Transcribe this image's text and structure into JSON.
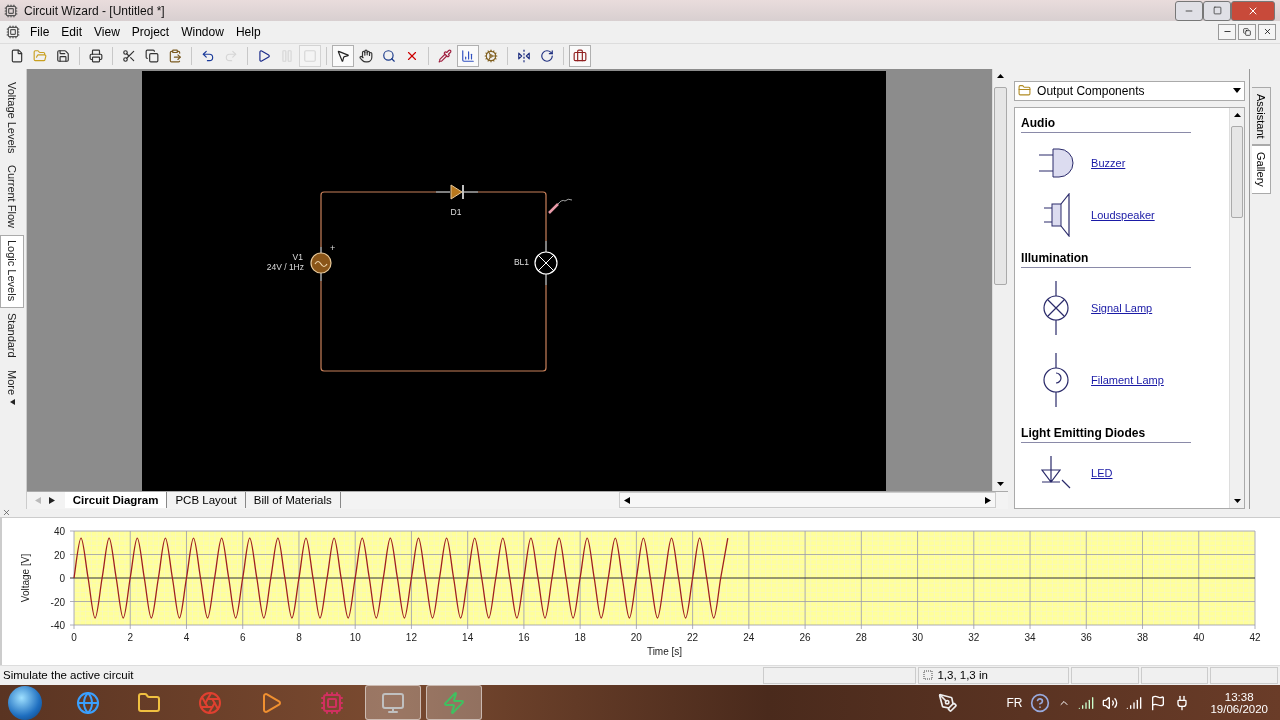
{
  "window": {
    "title": "Circuit Wizard - [Untitled *]"
  },
  "menu": [
    "File",
    "Edit",
    "View",
    "Project",
    "Window",
    "Help"
  ],
  "toolbar": [
    {
      "disabled": false,
      "pressed": false
    },
    {
      "disabled": false,
      "pressed": false
    },
    {
      "disabled": false,
      "pressed": false
    },
    {
      "disabled": false,
      "pressed": false
    },
    {
      "disabled": false,
      "pressed": false
    },
    {
      "disabled": false,
      "pressed": false
    },
    {
      "disabled": false,
      "pressed": false
    },
    {
      "disabled": false,
      "pressed": false
    },
    {
      "disabled": true,
      "pressed": false
    },
    {
      "disabled": false,
      "pressed": false
    },
    {
      "disabled": true,
      "pressed": false
    },
    {
      "disabled": true,
      "pressed": true
    },
    {
      "disabled": false,
      "pressed": true
    },
    {
      "disabled": false,
      "pressed": false
    },
    {
      "disabled": false,
      "pressed": false
    },
    {
      "disabled": false,
      "pressed": false
    },
    {
      "disabled": false,
      "pressed": false
    },
    {
      "disabled": false,
      "pressed": true
    },
    {
      "disabled": false,
      "pressed": false
    },
    {
      "disabled": false,
      "pressed": false
    },
    {
      "disabled": false,
      "pressed": false
    },
    {
      "disabled": false,
      "pressed": true
    }
  ],
  "view_tabs": [
    {
      "label": "Voltage Levels",
      "selected": false,
      "dropdown": false
    },
    {
      "label": "Current Flow",
      "selected": false,
      "dropdown": false
    },
    {
      "label": "Logic Levels",
      "selected": true,
      "dropdown": false
    },
    {
      "label": "Standard",
      "selected": false,
      "dropdown": false
    },
    {
      "label": "More",
      "selected": false,
      "dropdown": true
    }
  ],
  "diagram": {
    "components": [
      {
        "kind": "source",
        "name": "V1",
        "value": "24V / 1Hz",
        "polarity": "+"
      },
      {
        "kind": "diode",
        "name": "D1"
      },
      {
        "kind": "lamp",
        "name": "BL1"
      }
    ]
  },
  "document_tabs": [
    {
      "label": "Circuit Diagram",
      "selected": true
    },
    {
      "label": "PCB Layout",
      "selected": false
    },
    {
      "label": "Bill of Materials",
      "selected": false
    }
  ],
  "gallery": {
    "category": "Output Components",
    "sections": [
      {
        "heading": "Audio",
        "items": [
          "Buzzer",
          "Loudspeaker"
        ]
      },
      {
        "heading": "Illumination",
        "items": [
          "Signal Lamp",
          "Filament Lamp"
        ]
      },
      {
        "heading": "Light Emitting Diodes",
        "items": [
          "LED"
        ]
      }
    ]
  },
  "side_tabs": [
    {
      "label": "Assistant",
      "selected": false
    },
    {
      "label": "Gallery",
      "selected": true
    }
  ],
  "graph": {
    "chart_data": {
      "type": "line",
      "grid": true,
      "xlabel": "Time [s]",
      "ylabel": "Voltage [V]",
      "xlim": [
        0,
        42
      ],
      "ylim": [
        -40,
        40
      ],
      "xticks": [
        0,
        2,
        4,
        6,
        8,
        10,
        12,
        14,
        16,
        18,
        20,
        22,
        24,
        26,
        28,
        30,
        32,
        34,
        36,
        38,
        40,
        42
      ],
      "yticks": [
        -40,
        -20,
        0,
        20,
        40
      ],
      "x": [
        0,
        0.25,
        0.5,
        0.75,
        1,
        1.25,
        1.5,
        1.75,
        2,
        2.25,
        2.5,
        2.75,
        3,
        3.25,
        3.5,
        3.75,
        4,
        4.25,
        4.5,
        4.75,
        5,
        5.25,
        5.5,
        5.75,
        6,
        6.25,
        6.5,
        6.75,
        7,
        7.25,
        7.5,
        7.75,
        8,
        8.25,
        8.5,
        8.75,
        9,
        9.25,
        9.5,
        9.75,
        10,
        10.25,
        10.5,
        10.75,
        11,
        11.25,
        11.5,
        11.75,
        12,
        12.25,
        12.5,
        12.75,
        13,
        13.25,
        13.5,
        13.75,
        14,
        14.25,
        14.5,
        14.75,
        15,
        15.25,
        15.5,
        15.75,
        16,
        16.25,
        16.5,
        16.75,
        17,
        17.25,
        17.5,
        17.75,
        18,
        18.25,
        18.5,
        18.75,
        19,
        19.25,
        19.5,
        19.75,
        20,
        20.25,
        20.5,
        20.75,
        21,
        21.25,
        21.5,
        21.75,
        22,
        22.25,
        22.5,
        22.75,
        23,
        23.25
      ],
      "series": [
        {
          "color": "#a02020",
          "values": [
            0,
            34,
            0,
            -34,
            0,
            34,
            0,
            -34,
            0,
            34,
            0,
            -34,
            0,
            34,
            0,
            -34,
            0,
            34,
            0,
            -34,
            0,
            34,
            0,
            -34,
            0,
            34,
            0,
            -34,
            0,
            34,
            0,
            -34,
            0,
            34,
            0,
            -34,
            0,
            34,
            0,
            -34,
            0,
            34,
            0,
            -34,
            0,
            34,
            0,
            -34,
            0,
            34,
            0,
            -34,
            0,
            34,
            0,
            -34,
            0,
            34,
            0,
            -34,
            0,
            34,
            0,
            -34,
            0,
            34,
            0,
            -34,
            0,
            34,
            0,
            -34,
            0,
            34,
            0,
            -34,
            0,
            34,
            0,
            -34,
            0,
            34,
            0,
            -34,
            0,
            34,
            0,
            -34,
            0,
            34,
            0,
            -34,
            0,
            34
          ]
        }
      ]
    }
  },
  "status_bar": {
    "message": "Simulate the active circuit",
    "position": "1,3, 1,3 in"
  },
  "taskbar": {
    "apps": [
      {
        "active": false
      },
      {
        "active": false
      },
      {
        "active": false
      },
      {
        "active": false
      },
      {
        "active": false
      },
      {
        "active": true
      },
      {
        "active": true
      }
    ],
    "language": "FR",
    "time": "13:38",
    "date": "19/06/2020"
  }
}
